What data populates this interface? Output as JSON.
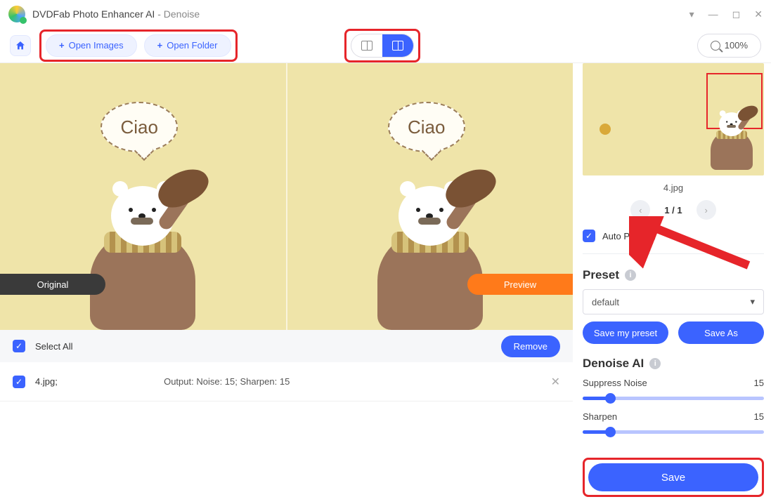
{
  "titlebar": {
    "app": "DVDFab Photo Enhancer AI",
    "mode": "Denoise"
  },
  "toolbar": {
    "open_images": "Open Images",
    "open_folder": "Open Folder",
    "zoom": "100%"
  },
  "preview": {
    "bubble_text": "Ciao",
    "original_label": "Original",
    "preview_label": "Preview"
  },
  "filelist": {
    "select_all": "Select All",
    "remove": "Remove",
    "items": [
      {
        "name": "4.jpg;",
        "output": "Output: Noise: 15; Sharpen: 15"
      }
    ]
  },
  "side": {
    "filename": "4.jpg",
    "page": "1 / 1",
    "auto_preview": "Auto Preview",
    "preset_title": "Preset",
    "preset_value": "default",
    "save_preset": "Save my preset",
    "save_as": "Save As",
    "denoise_title": "Denoise AI",
    "suppress_label": "Suppress Noise",
    "suppress_value": "15",
    "sharpen_label": "Sharpen",
    "sharpen_value": "15",
    "save": "Save"
  }
}
